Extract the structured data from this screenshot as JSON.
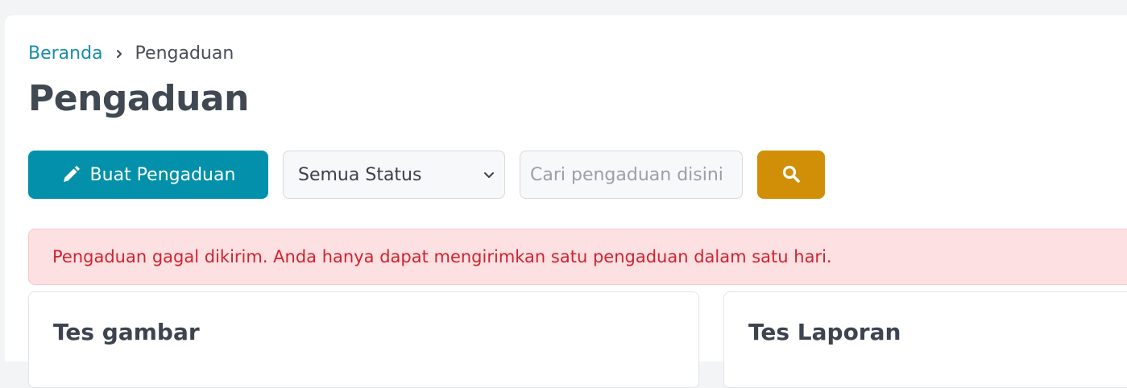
{
  "breadcrumb": {
    "home": "Beranda",
    "separator_icon": "chevron-right-icon",
    "current": "Pengaduan"
  },
  "page": {
    "title": "Pengaduan"
  },
  "toolbar": {
    "create_label": "Buat Pengaduan",
    "create_icon": "pencil-icon",
    "status_selected": "Semua Status",
    "search_placeholder": "Cari pengaduan disini",
    "search_icon": "search-icon"
  },
  "alert": {
    "message": "Pengaduan gagal dikirim. Anda hanya dapat mengirimkan satu pengaduan dalam satu hari."
  },
  "cards": [
    {
      "title": "Tes gambar"
    },
    {
      "title": "Tes Laporan"
    }
  ],
  "colors": {
    "primary": "#0290ab",
    "search_button": "#d18f07",
    "alert_bg": "#fde0e1",
    "alert_text": "#cf2330",
    "link": "#1a8ca8"
  }
}
